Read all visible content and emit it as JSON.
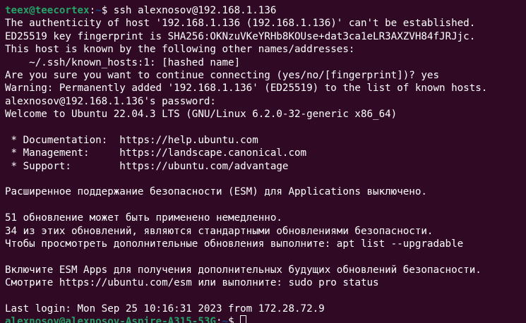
{
  "terminal": {
    "first_prompt": {
      "user_host": "teex@teecortex",
      "separator": ":",
      "path": "~",
      "symbol": "$ ",
      "command": "ssh alexnosov@192.168.1.136"
    },
    "output_top": [
      "The authenticity of host '192.168.1.136 (192.168.1.136)' can't be established.",
      "ED25519 key fingerprint is SHA256:OKNzuVKeYRHb8KOUse+dat3ca1eLR3AXZVH84fJRJjc.",
      "This host is known by the following other names/addresses:",
      "    ~/.ssh/known_hosts:1: [hashed name]",
      "Are you sure you want to continue connecting (yes/no/[fingerprint])? yes",
      "Warning: Permanently added '192.168.1.136' (ED25519) to the list of known hosts.",
      "alexnosov@192.168.1.136's password:",
      "Welcome to Ubuntu 22.04.3 LTS (GNU/Linux 6.2.0-32-generic x86_64)",
      "",
      " * Documentation:  https://help.ubuntu.com",
      " * Management:     https://landscape.canonical.com",
      " * Support:        https://ubuntu.com/advantage",
      "",
      "Расширенное поддержание безопасности (ESM) для Applications выключено.",
      "",
      "51 обновление может быть применено немедленно.",
      "34 из этих обновлений, являются стандартными обновлениями безопасности.",
      "Чтобы просмотреть дополнительные обновления выполните: apt list --upgradable",
      "",
      "Включите ESM Apps для получения дополнительных будущих обновлений безопасности.",
      "Смотрите https://ubuntu.com/esm или выполните: sudo pro status",
      "",
      "Last login: Mon Sep 25 10:16:31 2023 from 172.28.72.9"
    ],
    "last_prompt": {
      "user_host": "alexnosov@alexnosov-Aspire-A315-53G",
      "separator": ":",
      "path": "~",
      "symbol": "$ "
    }
  },
  "colors": {
    "background": "#300a24",
    "prompt_user": "#26a269",
    "prompt_path": "#12488b",
    "text": "#ffffff"
  }
}
